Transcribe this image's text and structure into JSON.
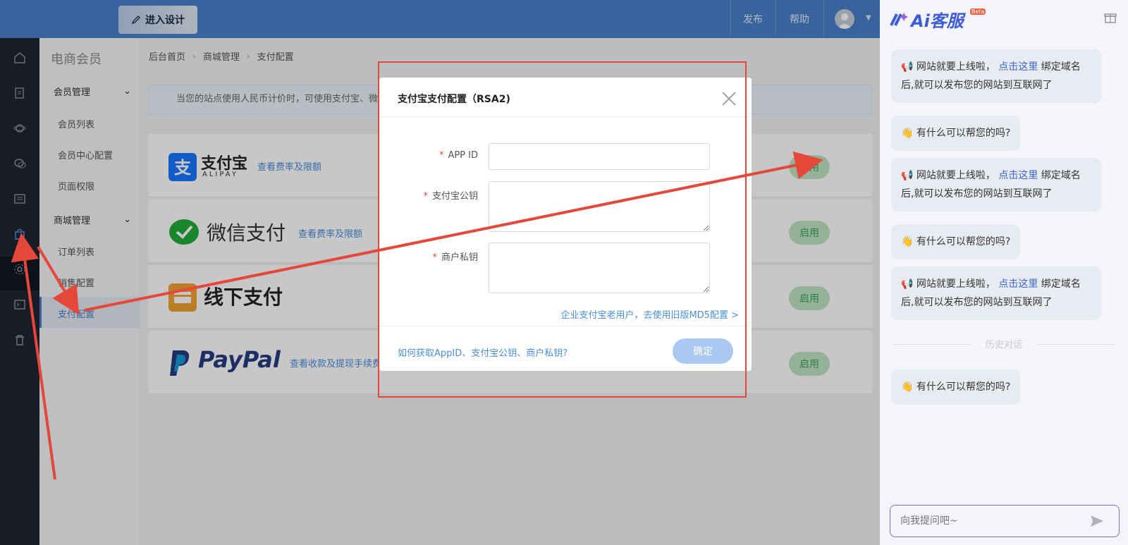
{
  "topbar": {
    "design_button": "进入设计",
    "publish": "发布",
    "help": "帮助"
  },
  "sidebar": {
    "title": "电商会员",
    "groups": [
      {
        "label": "会员管理",
        "items": [
          "会员列表",
          "会员中心配置",
          "页面权限"
        ]
      },
      {
        "label": "商城管理",
        "items": [
          "订单列表",
          "销售配置",
          "支付配置"
        ]
      }
    ]
  },
  "breadcrumb": [
    "后台首页",
    "商城管理",
    "支付配置"
  ],
  "notice": "当您的站点使用人民币计价时，可使用支付宝、微",
  "payments": [
    {
      "name": "支付宝",
      "sub": "ALIPAY",
      "link": "查看费率及限额",
      "button": "启用"
    },
    {
      "name": "微信支付",
      "link": "查看费率及限额",
      "button": "启用"
    },
    {
      "name": "线下支付",
      "button": "启用"
    },
    {
      "name": "PayPal",
      "link": "查看收款及提现手续费",
      "button": "启用"
    }
  ],
  "modal": {
    "title": "支付宝支付配置（RSA2)",
    "fields": [
      {
        "label": "APP ID",
        "value": ""
      },
      {
        "label": "支付宝公钥",
        "value": ""
      },
      {
        "label": "商户私钥",
        "value": ""
      }
    ],
    "legacy_link": "企业支付宝老用户，去使用旧版MD5配置 >",
    "help_link": "如何获取AppID、支付宝公钥、商户私钥?",
    "confirm": "确定"
  },
  "chat": {
    "brand": "Ai客服",
    "beta": "Beta",
    "messages": [
      {
        "type": "notice",
        "before": "网站就要上线啦，",
        "link": "点击这里",
        "after": "绑定域名后,就可以发布您的网站到互联网了"
      },
      {
        "type": "greet",
        "text": "有什么可以帮您的吗?"
      },
      {
        "type": "notice",
        "before": "网站就要上线啦，",
        "link": "点击这里",
        "after": "绑定域名后,就可以发布您的网站到互联网了"
      },
      {
        "type": "greet",
        "text": "有什么可以帮您的吗?"
      },
      {
        "type": "notice",
        "before": "网站就要上线啦，",
        "link": "点击这里",
        "after": "绑定域名后,就可以发布您的网站到互联网了"
      }
    ],
    "history_label": "历史对话",
    "last_message": "有什么可以帮您的吗?",
    "input_placeholder": "向我提问吧~"
  },
  "colors": {
    "primary": "#4a7fc8",
    "accent_red": "#e5473a",
    "enable_green": "#3aa356",
    "link_blue": "#4a8ed8"
  }
}
